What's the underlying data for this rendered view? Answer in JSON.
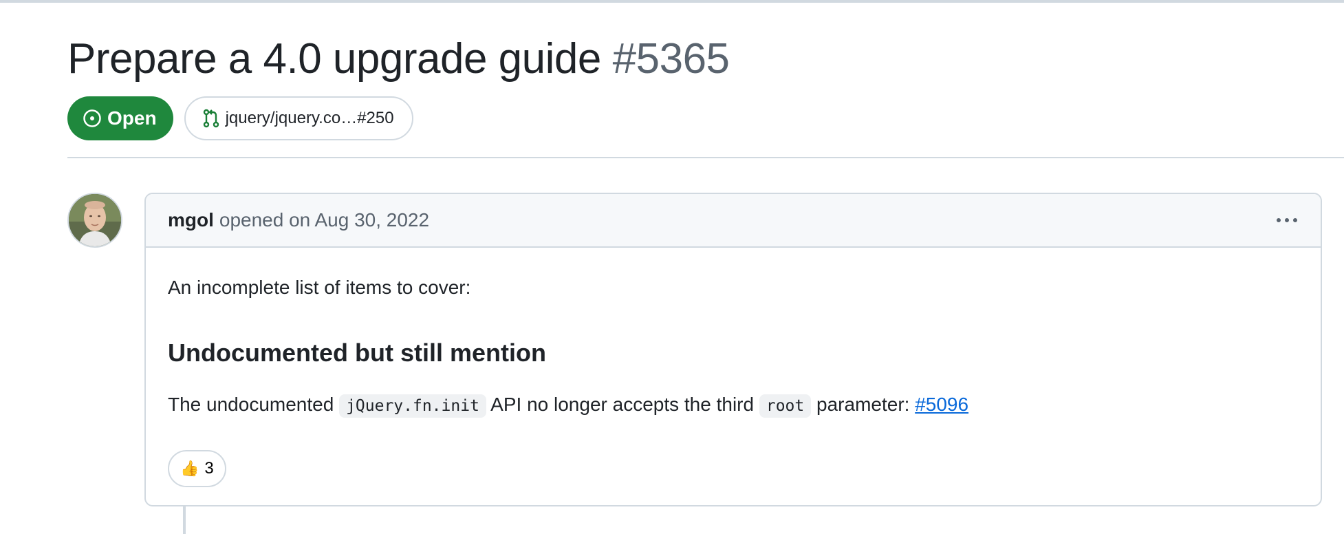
{
  "issue": {
    "title": "Prepare a 4.0 upgrade guide",
    "number": "#5365",
    "state_label": "Open",
    "linked_pr_label": "jquery/jquery.co…#250"
  },
  "comment": {
    "author": "mgol",
    "opened_text": "opened on Aug 30, 2022",
    "intro": "An incomplete list of items to cover:",
    "heading": "Undocumented but still mention",
    "text_before_code": "The undocumented",
    "code_1": "jQuery.fn.init",
    "text_middle": "API no longer accepts the third",
    "code_2": "root",
    "text_after_code": "parameter:",
    "issue_ref": "#5096",
    "reaction": {
      "emoji": "👍",
      "count": "3"
    }
  },
  "colors": {
    "open_green": "#1f883d",
    "link_blue": "#0969da",
    "border": "#d1d9e0",
    "muted_text": "#59636e"
  },
  "icons": [
    "issue-opened-icon",
    "git-pull-request-icon",
    "kebab-horizontal-icon",
    "thumbs-up-icon"
  ]
}
